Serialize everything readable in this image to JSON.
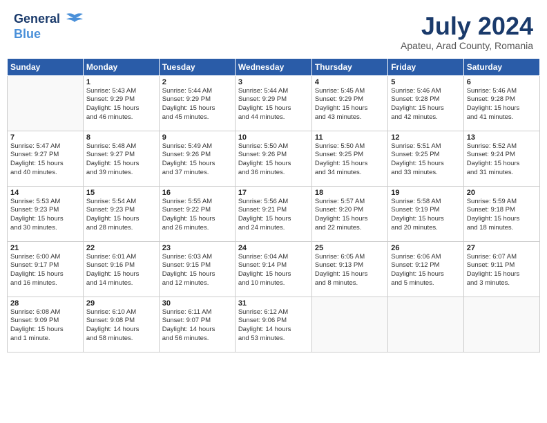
{
  "header": {
    "logo_general": "General",
    "logo_blue": "Blue",
    "month_year": "July 2024",
    "location": "Apateu, Arad County, Romania"
  },
  "columns": [
    "Sunday",
    "Monday",
    "Tuesday",
    "Wednesday",
    "Thursday",
    "Friday",
    "Saturday"
  ],
  "weeks": [
    [
      {
        "day": "",
        "info": ""
      },
      {
        "day": "1",
        "info": "Sunrise: 5:43 AM\nSunset: 9:29 PM\nDaylight: 15 hours\nand 46 minutes."
      },
      {
        "day": "2",
        "info": "Sunrise: 5:44 AM\nSunset: 9:29 PM\nDaylight: 15 hours\nand 45 minutes."
      },
      {
        "day": "3",
        "info": "Sunrise: 5:44 AM\nSunset: 9:29 PM\nDaylight: 15 hours\nand 44 minutes."
      },
      {
        "day": "4",
        "info": "Sunrise: 5:45 AM\nSunset: 9:29 PM\nDaylight: 15 hours\nand 43 minutes."
      },
      {
        "day": "5",
        "info": "Sunrise: 5:46 AM\nSunset: 9:28 PM\nDaylight: 15 hours\nand 42 minutes."
      },
      {
        "day": "6",
        "info": "Sunrise: 5:46 AM\nSunset: 9:28 PM\nDaylight: 15 hours\nand 41 minutes."
      }
    ],
    [
      {
        "day": "7",
        "info": "Sunrise: 5:47 AM\nSunset: 9:27 PM\nDaylight: 15 hours\nand 40 minutes."
      },
      {
        "day": "8",
        "info": "Sunrise: 5:48 AM\nSunset: 9:27 PM\nDaylight: 15 hours\nand 39 minutes."
      },
      {
        "day": "9",
        "info": "Sunrise: 5:49 AM\nSunset: 9:26 PM\nDaylight: 15 hours\nand 37 minutes."
      },
      {
        "day": "10",
        "info": "Sunrise: 5:50 AM\nSunset: 9:26 PM\nDaylight: 15 hours\nand 36 minutes."
      },
      {
        "day": "11",
        "info": "Sunrise: 5:50 AM\nSunset: 9:25 PM\nDaylight: 15 hours\nand 34 minutes."
      },
      {
        "day": "12",
        "info": "Sunrise: 5:51 AM\nSunset: 9:25 PM\nDaylight: 15 hours\nand 33 minutes."
      },
      {
        "day": "13",
        "info": "Sunrise: 5:52 AM\nSunset: 9:24 PM\nDaylight: 15 hours\nand 31 minutes."
      }
    ],
    [
      {
        "day": "14",
        "info": "Sunrise: 5:53 AM\nSunset: 9:23 PM\nDaylight: 15 hours\nand 30 minutes."
      },
      {
        "day": "15",
        "info": "Sunrise: 5:54 AM\nSunset: 9:23 PM\nDaylight: 15 hours\nand 28 minutes."
      },
      {
        "day": "16",
        "info": "Sunrise: 5:55 AM\nSunset: 9:22 PM\nDaylight: 15 hours\nand 26 minutes."
      },
      {
        "day": "17",
        "info": "Sunrise: 5:56 AM\nSunset: 9:21 PM\nDaylight: 15 hours\nand 24 minutes."
      },
      {
        "day": "18",
        "info": "Sunrise: 5:57 AM\nSunset: 9:20 PM\nDaylight: 15 hours\nand 22 minutes."
      },
      {
        "day": "19",
        "info": "Sunrise: 5:58 AM\nSunset: 9:19 PM\nDaylight: 15 hours\nand 20 minutes."
      },
      {
        "day": "20",
        "info": "Sunrise: 5:59 AM\nSunset: 9:18 PM\nDaylight: 15 hours\nand 18 minutes."
      }
    ],
    [
      {
        "day": "21",
        "info": "Sunrise: 6:00 AM\nSunset: 9:17 PM\nDaylight: 15 hours\nand 16 minutes."
      },
      {
        "day": "22",
        "info": "Sunrise: 6:01 AM\nSunset: 9:16 PM\nDaylight: 15 hours\nand 14 minutes."
      },
      {
        "day": "23",
        "info": "Sunrise: 6:03 AM\nSunset: 9:15 PM\nDaylight: 15 hours\nand 12 minutes."
      },
      {
        "day": "24",
        "info": "Sunrise: 6:04 AM\nSunset: 9:14 PM\nDaylight: 15 hours\nand 10 minutes."
      },
      {
        "day": "25",
        "info": "Sunrise: 6:05 AM\nSunset: 9:13 PM\nDaylight: 15 hours\nand 8 minutes."
      },
      {
        "day": "26",
        "info": "Sunrise: 6:06 AM\nSunset: 9:12 PM\nDaylight: 15 hours\nand 5 minutes."
      },
      {
        "day": "27",
        "info": "Sunrise: 6:07 AM\nSunset: 9:11 PM\nDaylight: 15 hours\nand 3 minutes."
      }
    ],
    [
      {
        "day": "28",
        "info": "Sunrise: 6:08 AM\nSunset: 9:09 PM\nDaylight: 15 hours\nand 1 minute."
      },
      {
        "day": "29",
        "info": "Sunrise: 6:10 AM\nSunset: 9:08 PM\nDaylight: 14 hours\nand 58 minutes."
      },
      {
        "day": "30",
        "info": "Sunrise: 6:11 AM\nSunset: 9:07 PM\nDaylight: 14 hours\nand 56 minutes."
      },
      {
        "day": "31",
        "info": "Sunrise: 6:12 AM\nSunset: 9:06 PM\nDaylight: 14 hours\nand 53 minutes."
      },
      {
        "day": "",
        "info": ""
      },
      {
        "day": "",
        "info": ""
      },
      {
        "day": "",
        "info": ""
      }
    ]
  ]
}
